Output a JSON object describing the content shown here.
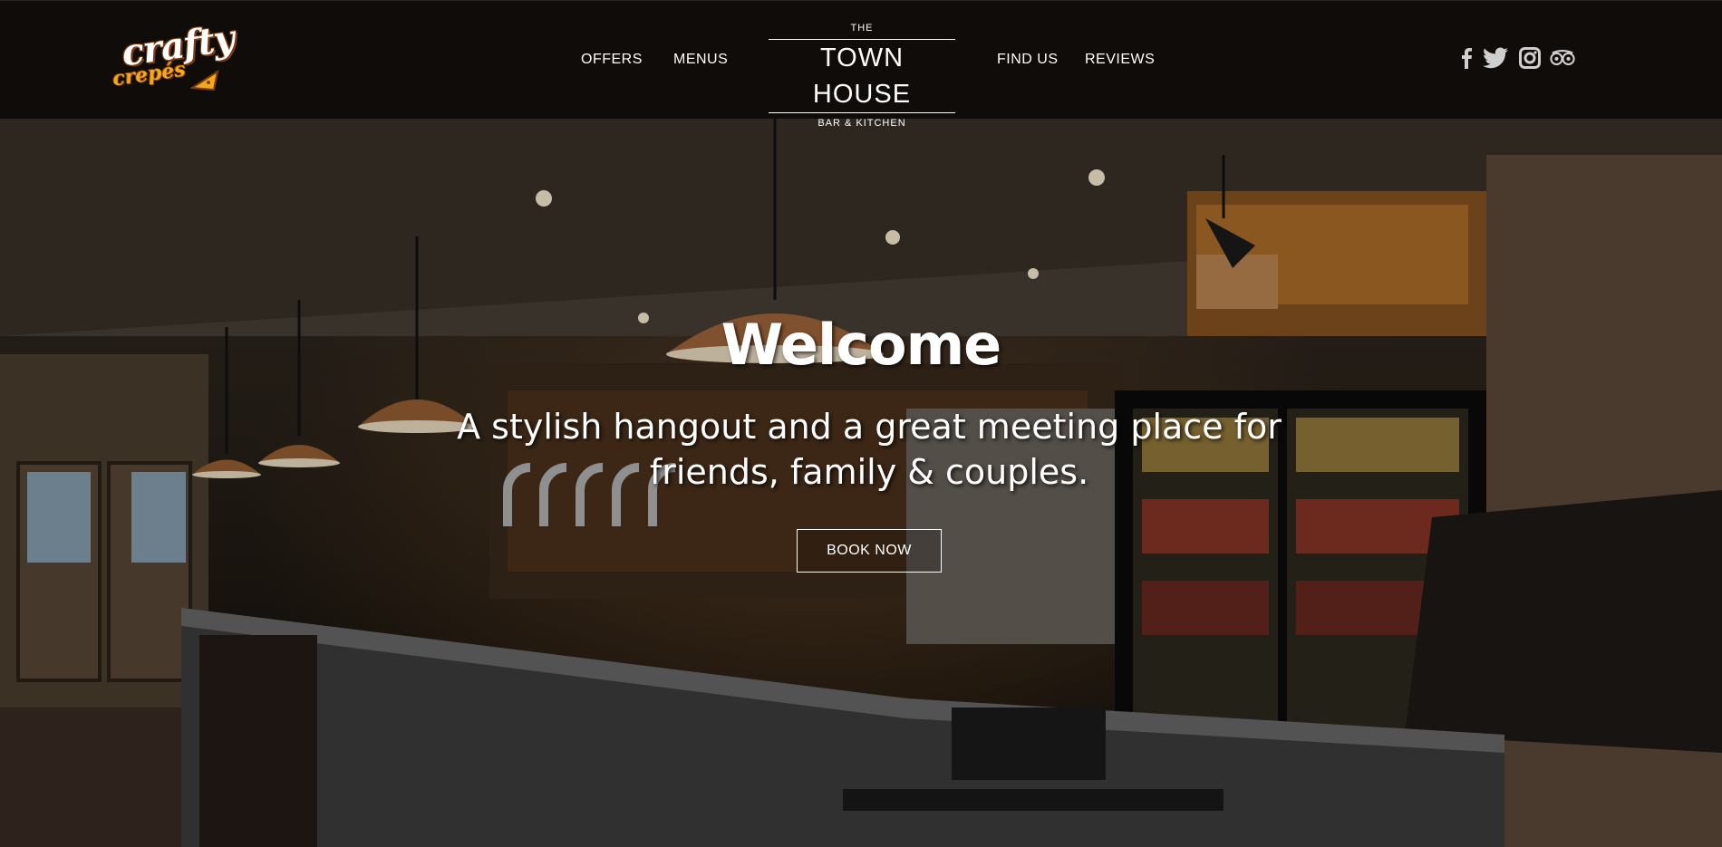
{
  "header": {
    "logo": {
      "line1": "crafty",
      "line2": "crepés"
    },
    "nav": {
      "offers": "OFFERS",
      "menus": "MENUS",
      "find_us": "FIND US",
      "reviews": "REVIEWS"
    },
    "brand": {
      "top": "THE",
      "main": "TOWN HOUSE",
      "sub": "BAR & KITCHEN"
    },
    "social": [
      "facebook-icon",
      "twitter-icon",
      "instagram-icon",
      "tripadvisor-icon"
    ]
  },
  "hero": {
    "title": "Welcome",
    "tagline": "A stylish hangout and a great meeting place for friends, family & couples.",
    "cta": "BOOK NOW",
    "background": "bar-interior-photo"
  },
  "colors": {
    "header_bg": "#0f0c09",
    "text": "#ffffff",
    "logo_accent": "#f2a91e",
    "logo_outline": "#7a3a12"
  }
}
